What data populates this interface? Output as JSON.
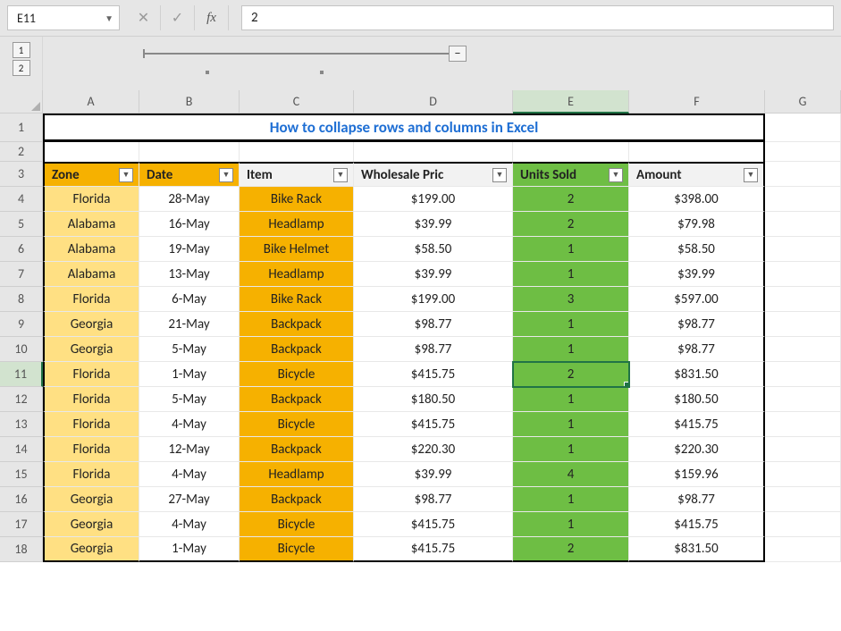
{
  "namebox": {
    "ref": "E11"
  },
  "formula_bar": {
    "cancel": "✕",
    "enter": "✓",
    "fx": "fx",
    "value": "2"
  },
  "outline": {
    "levels": [
      "1",
      "2"
    ],
    "collapse_symbol": "−"
  },
  "columns": [
    "A",
    "B",
    "C",
    "D",
    "E",
    "F",
    "G"
  ],
  "row_numbers": [
    "1",
    "2",
    "3",
    "4",
    "5",
    "6",
    "7",
    "8",
    "9",
    "10",
    "11",
    "12",
    "13",
    "14",
    "15",
    "16",
    "17",
    "18"
  ],
  "selected_cell": "E11",
  "title": "How to collapse rows and columns in Excel",
  "table": {
    "headers": {
      "zone": "Zone",
      "date": "Date",
      "item": "Item",
      "price": "Wholesale Pric",
      "units": "Units Sold",
      "amount": "Amount"
    },
    "rows": [
      {
        "zone": "Florida",
        "date": "28-May",
        "item": "Bike Rack",
        "price": "$199.00",
        "units": "2",
        "amount": "$398.00"
      },
      {
        "zone": "Alabama",
        "date": "16-May",
        "item": "Headlamp",
        "price": "$39.99",
        "units": "2",
        "amount": "$79.98"
      },
      {
        "zone": "Alabama",
        "date": "19-May",
        "item": "Bike Helmet",
        "price": "$58.50",
        "units": "1",
        "amount": "$58.50"
      },
      {
        "zone": "Alabama",
        "date": "13-May",
        "item": "Headlamp",
        "price": "$39.99",
        "units": "1",
        "amount": "$39.99"
      },
      {
        "zone": "Florida",
        "date": "6-May",
        "item": "Bike Rack",
        "price": "$199.00",
        "units": "3",
        "amount": "$597.00"
      },
      {
        "zone": "Georgia",
        "date": "21-May",
        "item": "Backpack",
        "price": "$98.77",
        "units": "1",
        "amount": "$98.77"
      },
      {
        "zone": "Georgia",
        "date": "5-May",
        "item": "Backpack",
        "price": "$98.77",
        "units": "1",
        "amount": "$98.77"
      },
      {
        "zone": "Florida",
        "date": "1-May",
        "item": "Bicycle",
        "price": "$415.75",
        "units": "2",
        "amount": "$831.50"
      },
      {
        "zone": "Florida",
        "date": "5-May",
        "item": "Backpack",
        "price": "$180.50",
        "units": "1",
        "amount": "$180.50"
      },
      {
        "zone": "Florida",
        "date": "4-May",
        "item": "Bicycle",
        "price": "$415.75",
        "units": "1",
        "amount": "$415.75"
      },
      {
        "zone": "Florida",
        "date": "12-May",
        "item": "Backpack",
        "price": "$220.30",
        "units": "1",
        "amount": "$220.30"
      },
      {
        "zone": "Florida",
        "date": "4-May",
        "item": "Headlamp",
        "price": "$39.99",
        "units": "4",
        "amount": "$159.96"
      },
      {
        "zone": "Georgia",
        "date": "27-May",
        "item": "Backpack",
        "price": "$98.77",
        "units": "1",
        "amount": "$98.77"
      },
      {
        "zone": "Georgia",
        "date": "4-May",
        "item": "Bicycle",
        "price": "$415.75",
        "units": "1",
        "amount": "$415.75"
      },
      {
        "zone": "Georgia",
        "date": "1-May",
        "item": "Bicycle",
        "price": "$415.75",
        "units": "2",
        "amount": "$831.50"
      }
    ]
  },
  "chart_data": {
    "type": "table",
    "title": "How to collapse rows and columns in Excel",
    "columns": [
      "Zone",
      "Date",
      "Item",
      "Wholesale Price",
      "Units Sold",
      "Amount"
    ],
    "rows": [
      [
        "Florida",
        "28-May",
        "Bike Rack",
        199.0,
        2,
        398.0
      ],
      [
        "Alabama",
        "16-May",
        "Headlamp",
        39.99,
        2,
        79.98
      ],
      [
        "Alabama",
        "19-May",
        "Bike Helmet",
        58.5,
        1,
        58.5
      ],
      [
        "Alabama",
        "13-May",
        "Headlamp",
        39.99,
        1,
        39.99
      ],
      [
        "Florida",
        "6-May",
        "Bike Rack",
        199.0,
        3,
        597.0
      ],
      [
        "Georgia",
        "21-May",
        "Backpack",
        98.77,
        1,
        98.77
      ],
      [
        "Georgia",
        "5-May",
        "Backpack",
        98.77,
        1,
        98.77
      ],
      [
        "Florida",
        "1-May",
        "Bicycle",
        415.75,
        2,
        831.5
      ],
      [
        "Florida",
        "5-May",
        "Backpack",
        180.5,
        1,
        180.5
      ],
      [
        "Florida",
        "4-May",
        "Bicycle",
        415.75,
        1,
        415.75
      ],
      [
        "Florida",
        "12-May",
        "Backpack",
        220.3,
        1,
        220.3
      ],
      [
        "Florida",
        "4-May",
        "Headlamp",
        39.99,
        4,
        159.96
      ],
      [
        "Georgia",
        "27-May",
        "Backpack",
        98.77,
        1,
        98.77
      ],
      [
        "Georgia",
        "4-May",
        "Bicycle",
        415.75,
        1,
        415.75
      ],
      [
        "Georgia",
        "1-May",
        "Bicycle",
        415.75,
        2,
        831.5
      ]
    ]
  }
}
